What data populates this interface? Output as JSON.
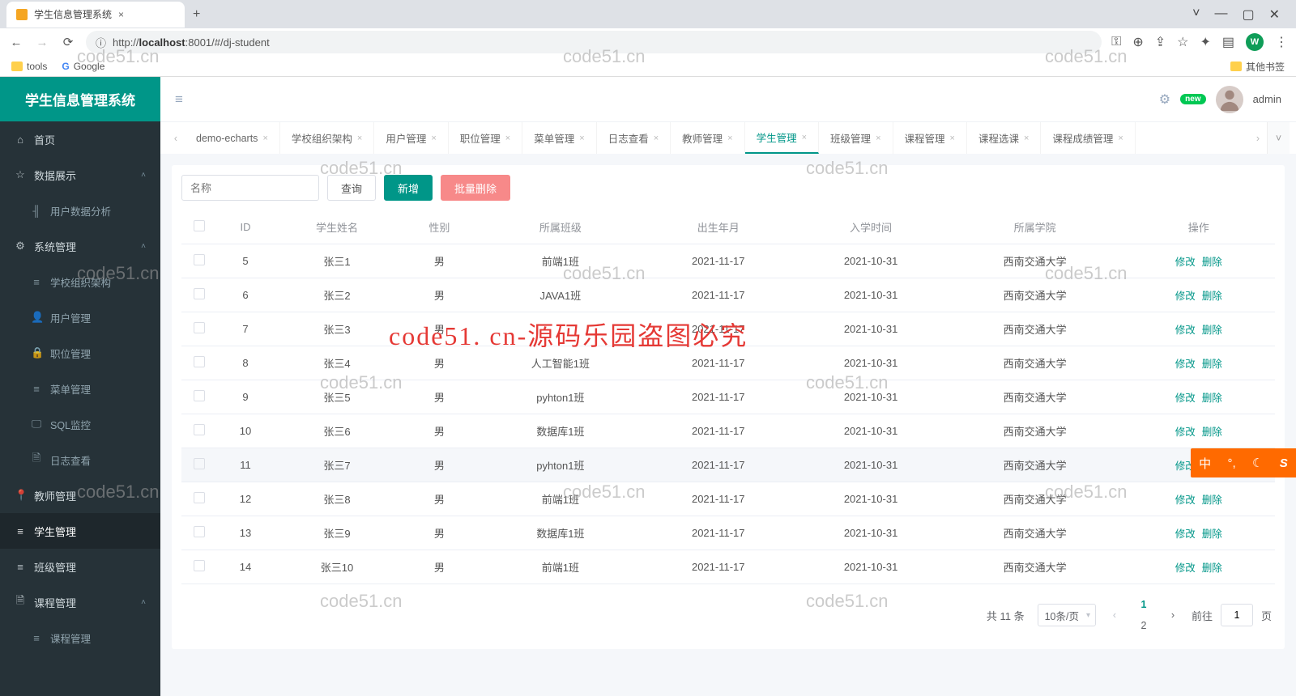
{
  "browser": {
    "tab_title": "学生信息管理系统",
    "url_full": "http://localhost:8001/#/dj-student",
    "url_host_bold": "localhost",
    "url_prefix": "http://",
    "url_port_path": ":8001/#/dj-student",
    "ext_letter": "W",
    "bookmarks": {
      "tools": "tools",
      "google": "Google",
      "other": "其他书签"
    }
  },
  "app": {
    "title": "学生信息管理系统",
    "username": "admin",
    "badge": "new"
  },
  "sidebar": {
    "home": "首页",
    "data_display": "数据展示",
    "user_data_analysis": "用户数据分析",
    "system_mgmt": "系统管理",
    "school_org": "学校组织架构",
    "user_mgmt": "用户管理",
    "position_mgmt": "职位管理",
    "menu_mgmt": "菜单管理",
    "sql_monitor": "SQL监控",
    "log_view": "日志查看",
    "teacher_mgmt": "教师管理",
    "student_mgmt": "学生管理",
    "class_mgmt": "班级管理",
    "course_mgmt": "课程管理",
    "course_mgmt_sub": "课程管理"
  },
  "tabs": [
    {
      "label": "demo-echarts",
      "active": false
    },
    {
      "label": "学校组织架构",
      "active": false
    },
    {
      "label": "用户管理",
      "active": false
    },
    {
      "label": "职位管理",
      "active": false
    },
    {
      "label": "菜单管理",
      "active": false
    },
    {
      "label": "日志查看",
      "active": false
    },
    {
      "label": "教师管理",
      "active": false
    },
    {
      "label": "学生管理",
      "active": true
    },
    {
      "label": "班级管理",
      "active": false
    },
    {
      "label": "课程管理",
      "active": false
    },
    {
      "label": "课程选课",
      "active": false
    },
    {
      "label": "课程成绩管理",
      "active": false
    }
  ],
  "filters": {
    "name_placeholder": "名称",
    "query": "查询",
    "add": "新增",
    "batch_delete": "批量删除"
  },
  "table": {
    "headers": [
      "",
      "ID",
      "学生姓名",
      "性别",
      "所属班级",
      "出生年月",
      "入学时间",
      "所属学院",
      "操作"
    ],
    "op_edit": "修改",
    "op_delete": "删除",
    "rows": [
      {
        "id": "5",
        "name": "张三1",
        "gender": "男",
        "class": "前端1班",
        "birth": "2021-11-17",
        "enroll": "2021-10-31",
        "college": "西南交通大学"
      },
      {
        "id": "6",
        "name": "张三2",
        "gender": "男",
        "class": "JAVA1班",
        "birth": "2021-11-17",
        "enroll": "2021-10-31",
        "college": "西南交通大学"
      },
      {
        "id": "7",
        "name": "张三3",
        "gender": "男",
        "class": "",
        "birth": "2021-11-17",
        "enroll": "2021-10-31",
        "college": "西南交通大学"
      },
      {
        "id": "8",
        "name": "张三4",
        "gender": "男",
        "class": "人工智能1班",
        "birth": "2021-11-17",
        "enroll": "2021-10-31",
        "college": "西南交通大学"
      },
      {
        "id": "9",
        "name": "张三5",
        "gender": "男",
        "class": "pyhton1班",
        "birth": "2021-11-17",
        "enroll": "2021-10-31",
        "college": "西南交通大学"
      },
      {
        "id": "10",
        "name": "张三6",
        "gender": "男",
        "class": "数据库1班",
        "birth": "2021-11-17",
        "enroll": "2021-10-31",
        "college": "西南交通大学"
      },
      {
        "id": "11",
        "name": "张三7",
        "gender": "男",
        "class": "pyhton1班",
        "birth": "2021-11-17",
        "enroll": "2021-10-31",
        "college": "西南交通大学",
        "hovered": true
      },
      {
        "id": "12",
        "name": "张三8",
        "gender": "男",
        "class": "前端1班",
        "birth": "2021-11-17",
        "enroll": "2021-10-31",
        "college": "西南交通大学"
      },
      {
        "id": "13",
        "name": "张三9",
        "gender": "男",
        "class": "数据库1班",
        "birth": "2021-11-17",
        "enroll": "2021-10-31",
        "college": "西南交通大学"
      },
      {
        "id": "14",
        "name": "张三10",
        "gender": "男",
        "class": "前端1班",
        "birth": "2021-11-17",
        "enroll": "2021-10-31",
        "college": "西南交通大学"
      }
    ]
  },
  "pagination": {
    "total_text": "共 11 条",
    "page_size": "10条/页",
    "pages": [
      "1",
      "2"
    ],
    "current": "1",
    "goto_label": "前往",
    "goto_value": "1",
    "page_suffix": "页"
  },
  "ime": {
    "lang": "中",
    "punct": "°,",
    "moon": "☾",
    "s": "S"
  },
  "watermarks": {
    "grey": "code51.cn",
    "red": "code51. cn-源码乐园盗图必究"
  }
}
